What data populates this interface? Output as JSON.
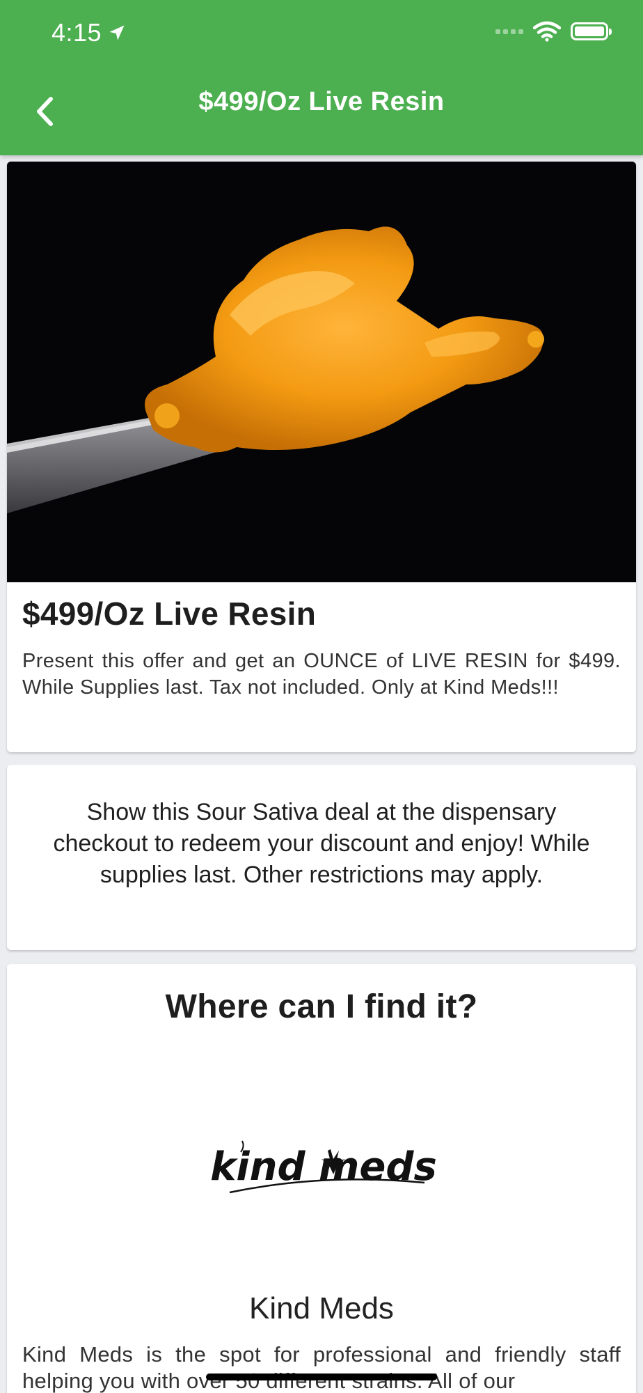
{
  "status_bar": {
    "time": "4:15",
    "icons": [
      "location-arrow-icon",
      "signal-icon",
      "wifi-icon",
      "battery-icon"
    ]
  },
  "header": {
    "title": "$499/Oz Live Resin",
    "back_icon": "chevron-left-icon",
    "background_color": "#4caf50"
  },
  "deal": {
    "image": "live-resin-photo",
    "title": "$499/Oz Live Resin",
    "description": "Present this offer and get an OUNCE of LIVE RESIN for $499. While Supplies last. Tax not included. Only at Kind Meds!!!"
  },
  "redeem": {
    "text": "Show this Sour Sativa deal at the dispensary checkout to redeem your discount and enjoy! While supplies last.  Other restrictions may apply."
  },
  "location": {
    "heading": "Where can I find it?",
    "logo_text": "kind meds",
    "store_name": "Kind Meds",
    "store_description": "Kind Meds is the spot for professional and friendly staff helping you with over 50 different strains. All of our"
  }
}
